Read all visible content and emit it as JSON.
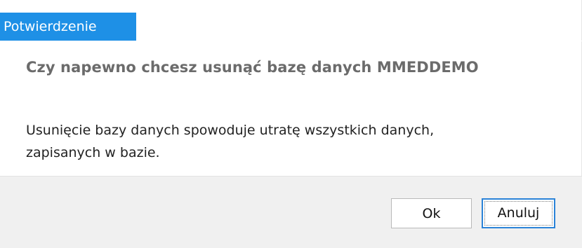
{
  "dialog": {
    "title": "Potwierdzenie",
    "question": "Czy napewno chcesz usunąć bazę danych MMEDDEMO",
    "message_lines": [
      "Usunięcie bazy danych spowoduje utratę wszystkich danych,",
      "zapisanych w bazie."
    ],
    "buttons": {
      "ok_label": "Ok",
      "cancel_label": "Anuluj"
    }
  },
  "colors": {
    "title_bg": "#1e90e6",
    "footer_bg": "#f0f0f0",
    "focus_border": "#2b83d8"
  }
}
